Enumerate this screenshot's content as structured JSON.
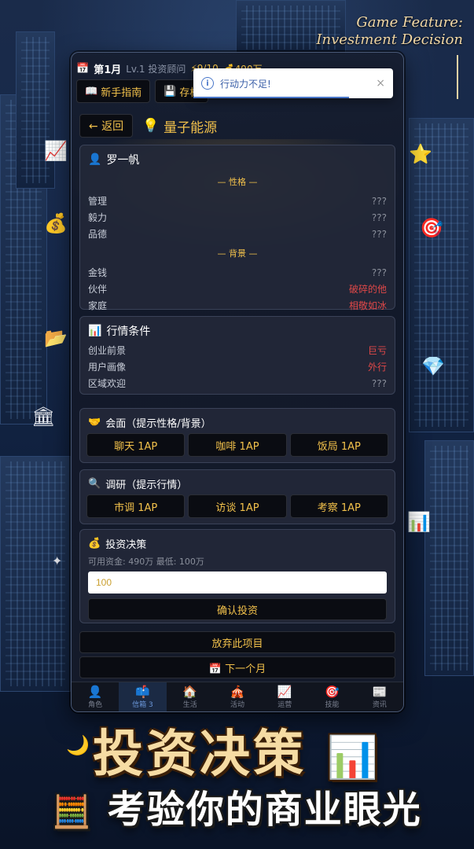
{
  "feature": {
    "line1": "Game Feature:",
    "line2": "Investment Decision"
  },
  "status": {
    "month": "第1月",
    "level": "Lv.1 投资顾问",
    "ap": "⚡9/10",
    "money": "💰490万"
  },
  "toolbar": {
    "guide": "新手指南",
    "save": "存档"
  },
  "toast": {
    "message": "行动力不足!",
    "close": "×"
  },
  "header": {
    "back": "← 返回",
    "title": "量子能源"
  },
  "person": {
    "name": "罗一帆",
    "personality_label": "— 性格 —",
    "personality": [
      {
        "k": "管理",
        "v": "???",
        "hl": false
      },
      {
        "k": "毅力",
        "v": "???",
        "hl": false
      },
      {
        "k": "品德",
        "v": "???",
        "hl": false
      }
    ],
    "background_label": "— 背景 —",
    "background": [
      {
        "k": "金钱",
        "v": "???",
        "hl": false
      },
      {
        "k": "伙伴",
        "v": "破碎的他",
        "hl": true
      },
      {
        "k": "家庭",
        "v": "相敬如冰",
        "hl": true
      }
    ]
  },
  "market": {
    "title": "行情条件",
    "rows": [
      {
        "k": "创业前景",
        "v": "巨亏",
        "hl": true
      },
      {
        "k": "用户画像",
        "v": "外行",
        "hl": true
      },
      {
        "k": "区域欢迎",
        "v": "???",
        "hl": false
      }
    ]
  },
  "meet": {
    "title": "会面（提示性格/背景）",
    "buttons": [
      "聊天 1AP",
      "咖啡 1AP",
      "饭局 1AP"
    ]
  },
  "research": {
    "title": "调研（提示行情）",
    "buttons": [
      "市调 1AP",
      "访谈 1AP",
      "考察 1AP"
    ]
  },
  "invest": {
    "title": "投资决策",
    "info": "可用资金: 490万   最低: 100万",
    "value": "100",
    "confirm": "确认投资"
  },
  "abandon": "放弃此项目",
  "next_month": "📅 下一个月",
  "tabs": [
    {
      "icon": "👤",
      "label": "角色",
      "active": false
    },
    {
      "icon": "📫",
      "label": "信箱 3",
      "active": true
    },
    {
      "icon": "🏠",
      "label": "生活",
      "active": false
    },
    {
      "icon": "🎪",
      "label": "活动",
      "active": false
    },
    {
      "icon": "📈",
      "label": "运营",
      "active": false
    },
    {
      "icon": "🎯",
      "label": "技能",
      "active": false
    },
    {
      "icon": "📰",
      "label": "资讯",
      "active": false
    }
  ],
  "headline": "投资决策",
  "subline": "考验你的商业眼光",
  "colors": {
    "accent": "#f2c14b",
    "danger": "#e04848",
    "info": "#4a77c9"
  }
}
